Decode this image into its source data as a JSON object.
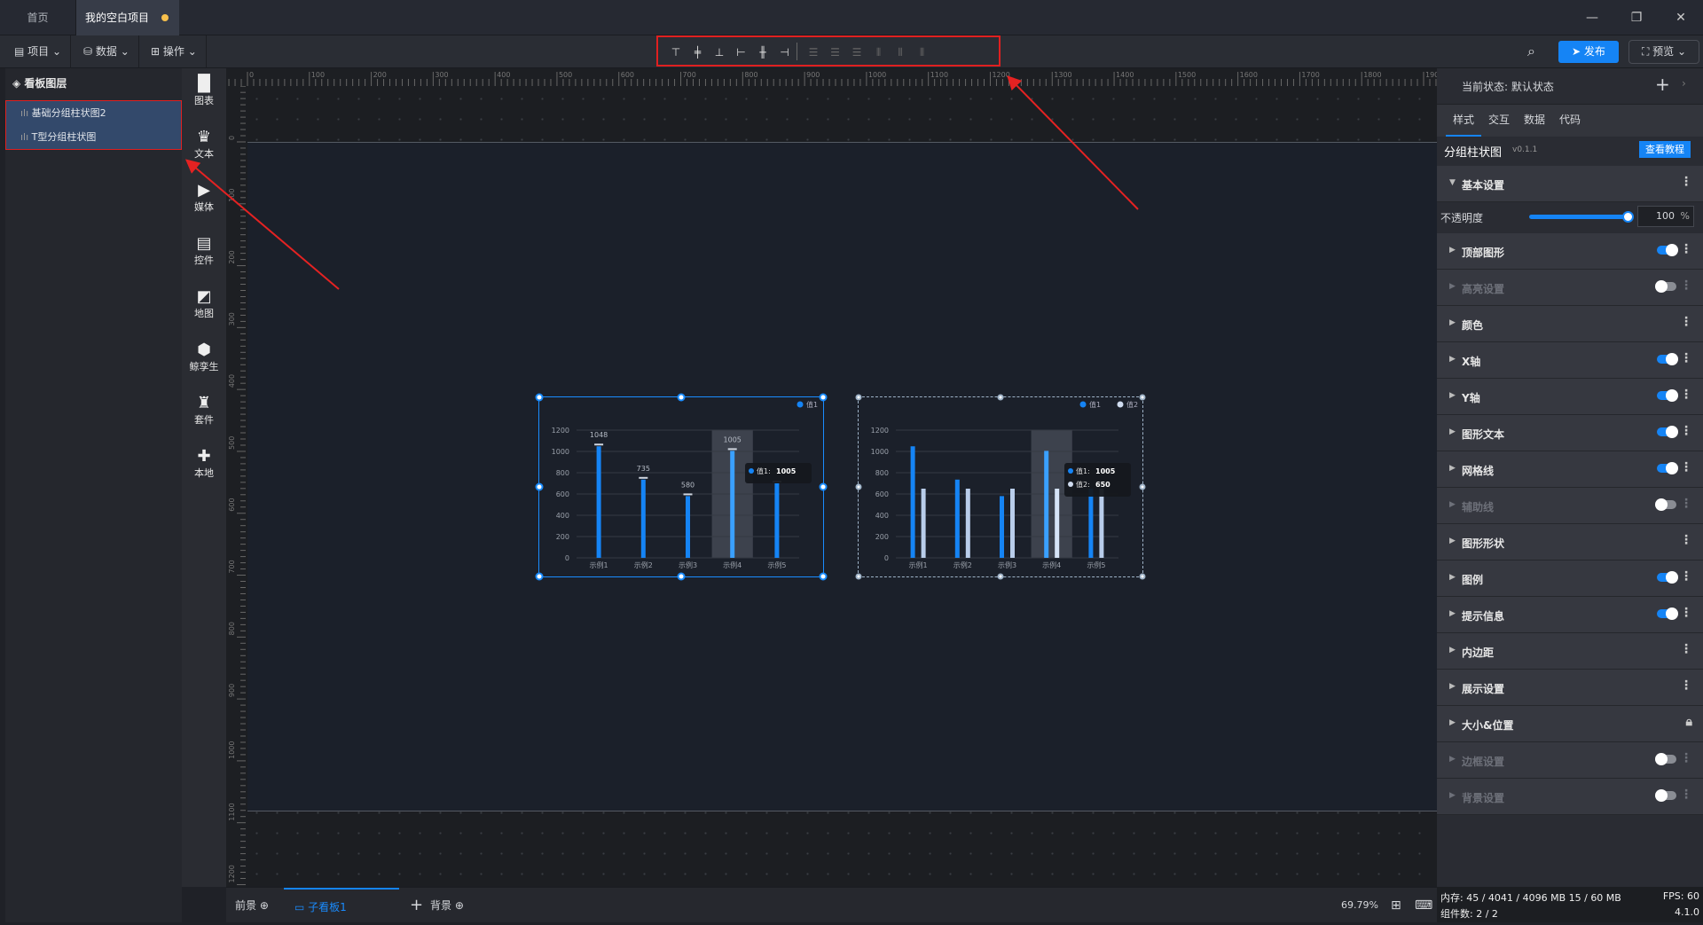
{
  "titlebar": {
    "tabs": [
      {
        "label": "首页"
      },
      {
        "label": "我的空白项目"
      }
    ],
    "window": {
      "minimize": "—",
      "maximize": "❐",
      "close": "✕"
    }
  },
  "toolbar": {
    "menus": [
      {
        "icon": "file-icon",
        "label": "项目"
      },
      {
        "icon": "database-icon",
        "label": "数据"
      },
      {
        "icon": "grid-icon",
        "label": "操作"
      }
    ],
    "align_icons": [
      {
        "name": "align-top",
        "glyph": "⊤",
        "enabled": true
      },
      {
        "name": "align-vcenter",
        "glyph": "╪",
        "enabled": true
      },
      {
        "name": "align-bottom",
        "glyph": "⊥",
        "enabled": true
      },
      {
        "name": "align-left",
        "glyph": "⊢",
        "enabled": true
      },
      {
        "name": "align-hcenter",
        "glyph": "╫",
        "enabled": true
      },
      {
        "name": "align-right",
        "glyph": "⊣",
        "enabled": true
      },
      {
        "name": "distribute-top",
        "glyph": "☰",
        "enabled": false
      },
      {
        "name": "distribute-vcenter",
        "glyph": "☰",
        "enabled": false
      },
      {
        "name": "distribute-bottom",
        "glyph": "☰",
        "enabled": false
      },
      {
        "name": "distribute-left",
        "glyph": "⫴",
        "enabled": false
      },
      {
        "name": "distribute-hcenter",
        "glyph": "⫴",
        "enabled": false
      },
      {
        "name": "distribute-right",
        "glyph": "⫴",
        "enabled": false
      }
    ],
    "publish": "发布",
    "preview": "预览"
  },
  "layers": {
    "title": "看板图层",
    "items": [
      {
        "label": "基础分组柱状图2"
      },
      {
        "label": "T型分组柱状图"
      }
    ]
  },
  "iconbar": [
    {
      "label": "图表",
      "glyph": "▐▌"
    },
    {
      "label": "文本",
      "glyph": "♛"
    },
    {
      "label": "媒体",
      "glyph": "▶"
    },
    {
      "label": "控件",
      "glyph": "▤"
    },
    {
      "label": "地图",
      "glyph": "◩"
    },
    {
      "label": "鲸孪生",
      "glyph": "⬢"
    },
    {
      "label": "套件",
      "glyph": "♜"
    },
    {
      "label": "本地",
      "glyph": "✚"
    }
  ],
  "bottom": {
    "foreground": "前景",
    "subboard": "子看板1",
    "add": "+",
    "background": "背景",
    "zoom": "69.79%"
  },
  "status": {
    "memory": "内存: 45 / 4041 / 4096 MB  15 / 60 MB",
    "fps": "FPS:  60",
    "components": "组件数: 2 / 2",
    "version": "4.1.0"
  },
  "right": {
    "state": "当前状态:  默认状态",
    "tabs": [
      "样式",
      "交互",
      "数据",
      "代码"
    ],
    "component": "分组柱状图",
    "version": "v0.1.1",
    "tutorial": "查看教程",
    "basic": "基本设置",
    "opacity_label": "不透明度",
    "opacity_value": "100",
    "opacity_unit": "%",
    "opacity": 100,
    "sections": [
      {
        "label": "顶部图形",
        "toggle": "on"
      },
      {
        "label": "高亮设置",
        "toggle": "off"
      },
      {
        "label": "颜色",
        "toggle": "none"
      },
      {
        "label": "X轴",
        "toggle": "on"
      },
      {
        "label": "Y轴",
        "toggle": "on"
      },
      {
        "label": "图形文本",
        "toggle": "on"
      },
      {
        "label": "网格线",
        "toggle": "on"
      },
      {
        "label": "辅助线",
        "toggle": "off"
      },
      {
        "label": "图形形状",
        "toggle": "none"
      },
      {
        "label": "图例",
        "toggle": "on"
      },
      {
        "label": "提示信息",
        "toggle": "on"
      },
      {
        "label": "内边距",
        "toggle": "none"
      },
      {
        "label": "展示设置",
        "toggle": "none"
      },
      {
        "label": "大小&位置",
        "toggle": "lock"
      },
      {
        "label": "边框设置",
        "toggle": "off"
      },
      {
        "label": "背景设置",
        "toggle": "off"
      }
    ]
  },
  "chart_data": [
    {
      "type": "bar",
      "title": "T型分组柱状图",
      "categories": [
        "示例1",
        "示例2",
        "示例3",
        "示例4",
        "示例5"
      ],
      "series": [
        {
          "name": "值1",
          "values": [
            1048,
            735,
            580,
            1005,
            700
          ],
          "color": "#1584f5"
        }
      ],
      "ylim": [
        0,
        1200
      ],
      "yticks": [
        0,
        200,
        400,
        600,
        800,
        1000,
        1200
      ],
      "legend": "top-right",
      "data_labels": true,
      "highlight_index": 3,
      "tooltip": {
        "label": "值1:",
        "value": "1005"
      }
    },
    {
      "type": "bar",
      "title": "基础分组柱状图2",
      "categories": [
        "示例1",
        "示例2",
        "示例3",
        "示例4",
        "示例5"
      ],
      "series": [
        {
          "name": "值1",
          "values": [
            1048,
            735,
            580,
            1005,
            650
          ],
          "color": "#1584f5"
        },
        {
          "name": "值2",
          "values": [
            650,
            650,
            650,
            650,
            650
          ],
          "color": "#b9cdea"
        }
      ],
      "ylim": [
        0,
        1200
      ],
      "yticks": [
        0,
        200,
        400,
        600,
        800,
        1000,
        1200
      ],
      "legend": "top-right",
      "highlight_index": 3,
      "tooltip": [
        {
          "label": "值1:",
          "value": "1005"
        },
        {
          "label": "值2:",
          "value": "650"
        }
      ]
    }
  ]
}
